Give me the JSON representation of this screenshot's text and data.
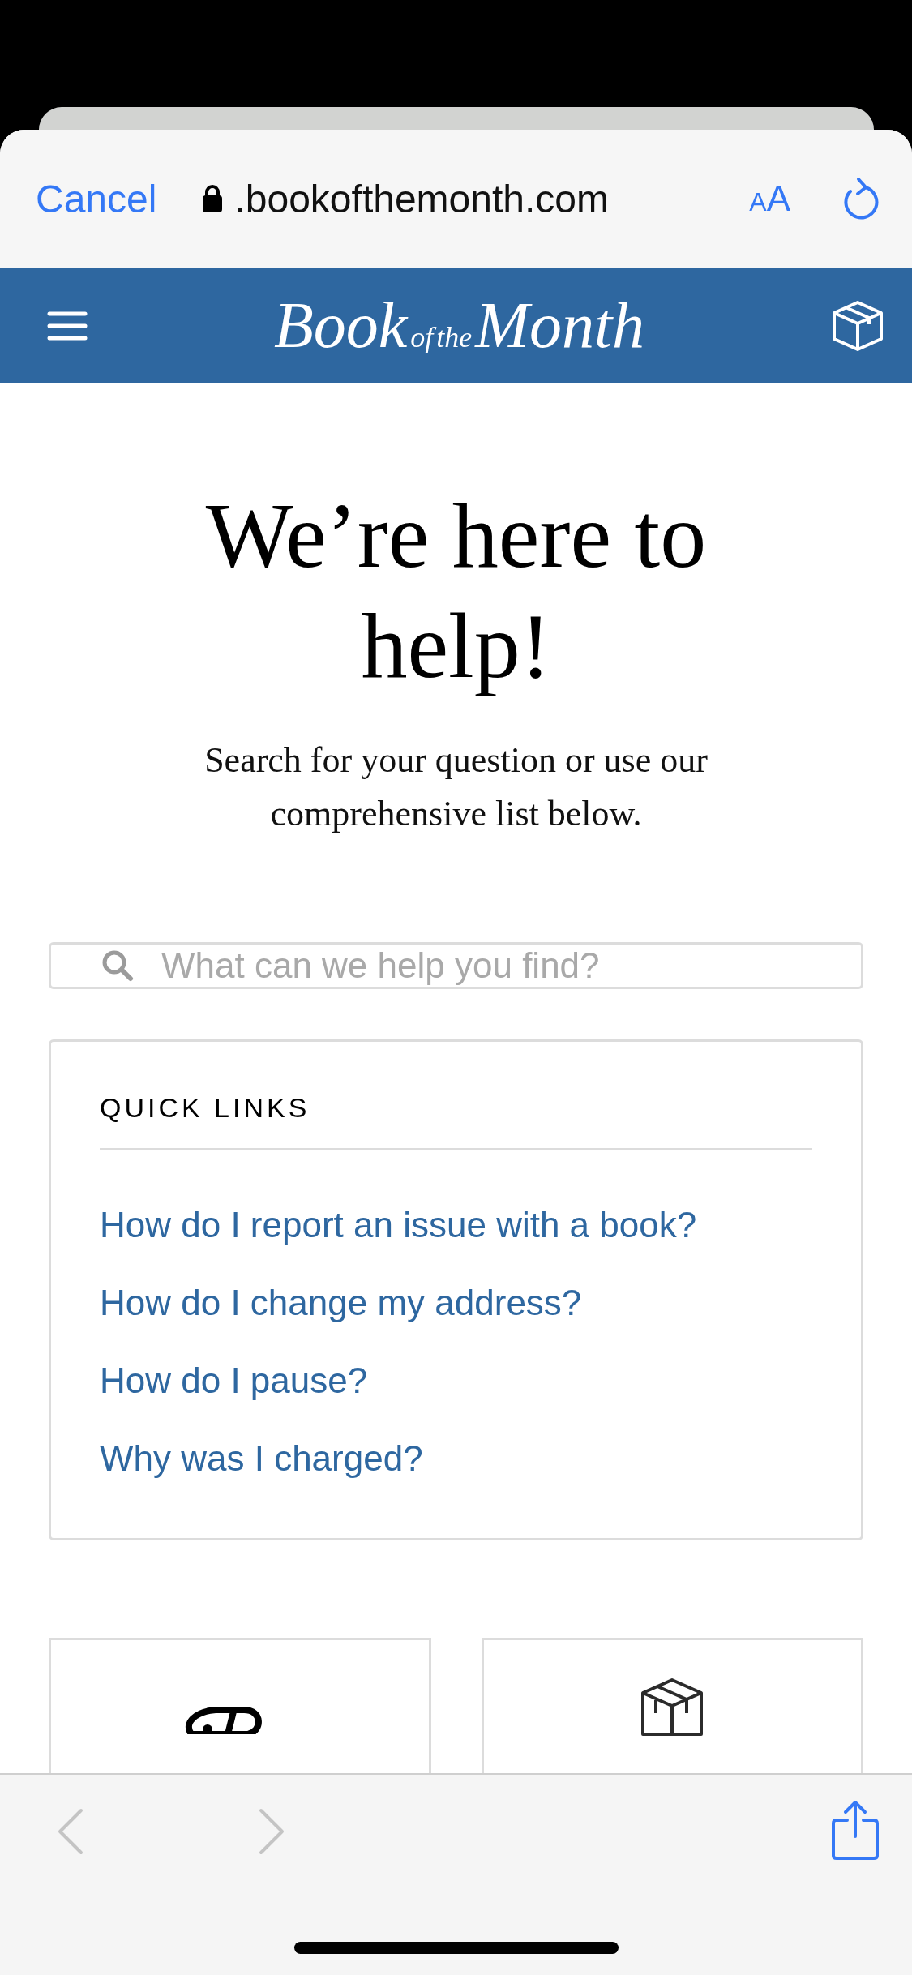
{
  "browser": {
    "cancel": "Cancel",
    "url": ".bookofthemonth.com",
    "text_size": {
      "small": "A",
      "large": "A"
    }
  },
  "header": {
    "logo": [
      {
        "text": "Book",
        "kind": "large"
      },
      {
        "text": "of",
        "kind": "small"
      },
      {
        "text": "the",
        "kind": "small"
      },
      {
        "text": "Month",
        "kind": "large"
      }
    ]
  },
  "hero": {
    "title": "We’re here to help!",
    "subtitle": "Search for your question or use our comprehensive list below."
  },
  "search": {
    "placeholder": "What can we help you find?"
  },
  "quick_links": {
    "title": "QUICK LINKS",
    "links": [
      "How do I report an issue with a book?",
      "How do I change my address?",
      "How do I pause?",
      "Why was I charged?"
    ]
  },
  "toolbar": {
    "back": {
      "disabled": true
    },
    "forward": {
      "disabled": true
    }
  }
}
